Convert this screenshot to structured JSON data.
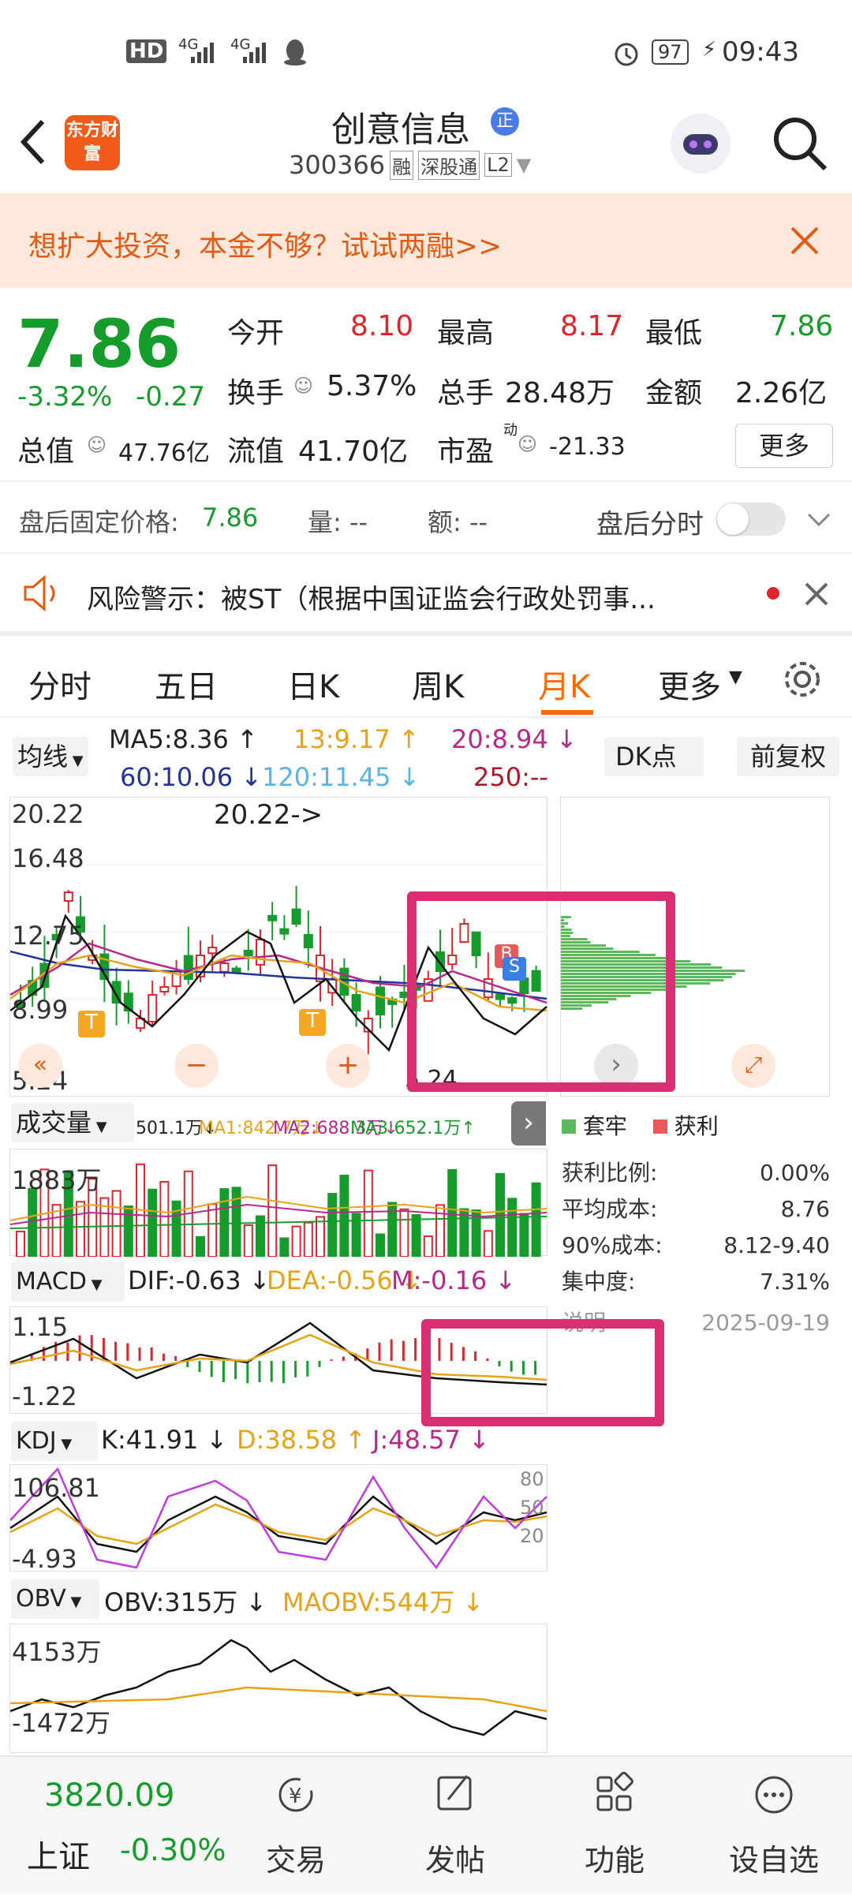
{
  "status_bar": {
    "net1": "4G",
    "net2": "4G",
    "battery": "97",
    "time": "09:43"
  },
  "header": {
    "logo_text": "东方财富",
    "stock_name": "创意信息",
    "name_badge": "正",
    "code": "300366",
    "tag1": "融",
    "tag2": "深股通",
    "tag3": "L2"
  },
  "banner": {
    "text": "想扩大投资，本金不够？试试两融>>"
  },
  "quote": {
    "price": "7.86",
    "change_pct": "-3.32%",
    "change": "-0.27",
    "open_label": "今开",
    "open": "8.10",
    "high_label": "最高",
    "high": "8.17",
    "low_label": "最低",
    "low": "7.86",
    "turnover_label": "换手",
    "turnover": "5.37%",
    "volume_label": "总手",
    "volume": "28.48万",
    "amount_label": "金额",
    "amount": "2.26亿",
    "mktcap_label": "总值",
    "mktcap": "47.76亿",
    "float_label": "流值",
    "float_cap": "41.70亿",
    "pe_label": "市盈",
    "pe_sup": "动",
    "pe": "-21.33",
    "more_label": "更多",
    "after_label": "盘后固定价格:",
    "after_price": "7.86",
    "after_vol": "量: --",
    "after_amt": "额: --",
    "after_timeshare": "盘后分时"
  },
  "warning": {
    "text": "风险警示：被ST（根据中国证监会行政处罚事..."
  },
  "tabs": [
    "分时",
    "五日",
    "日K",
    "周K",
    "月K",
    "更多"
  ],
  "ma": {
    "selector": "均线",
    "ma5": "MA5:8.36 ↑",
    "ma13": "13:9.17 ↑",
    "ma20": "20:8.94 ↓",
    "ma60": "60:10.06 ↓",
    "ma120": "120:11.45 ↓",
    "ma250": "250:--",
    "dk_button": "DK点",
    "adjust_button": "前复权"
  },
  "kline": {
    "y_top": "20.22",
    "y2": "16.48",
    "y3": "12.75",
    "y4": "8.99",
    "y_bottom": "5.24",
    "max_annot": "20.22->",
    "min_annot": "5.24",
    "marker_t": "T",
    "marker_b": "B",
    "marker_s": "S"
  },
  "volume": {
    "selector": "成交量",
    "v": "501.1万↓",
    "ma1": "MA1:842.7万↓",
    "ma2": "MA2:688.3万↓",
    "ma3": "MA3:652.1万↑",
    "y_top": "1883万"
  },
  "chip": {
    "legend_trap": "套牢",
    "legend_profit": "获利",
    "profit_ratio_label": "获利比例:",
    "profit_ratio": "0.00%",
    "avg_cost_label": "平均成本:",
    "avg_cost": "8.76",
    "cost90_label": "90%成本:",
    "cost90": "8.12-9.40",
    "concentration_label": "集中度:",
    "concentration": "7.31%",
    "note_label": "说明",
    "date": "2025-09-19"
  },
  "macd": {
    "selector": "MACD",
    "dif": "DIF:-0.63 ↓",
    "dea": "DEA:-0.56 ↓",
    "m": "M:-0.16 ↓",
    "y_top": "1.15",
    "y_bottom": "-1.22"
  },
  "kdj": {
    "selector": "KDJ",
    "k": "K:41.91 ↓",
    "d": "D:38.58 ↑",
    "j": "J:48.57 ↓",
    "y_top": "106.81",
    "y_bottom": "-4.93",
    "r80": "80",
    "r50": "50",
    "r20": "20"
  },
  "obv": {
    "selector": "OBV",
    "obv": "OBV:315万 ↓",
    "maobv": "MAOBV:544万 ↓",
    "y_top": "4153万",
    "y_bottom": "-1472万"
  },
  "bottom_nav": {
    "index_value": "3820.09",
    "index_name": "上证",
    "index_change": "-0.30%",
    "trade": "交易",
    "post": "发帖",
    "function": "功能",
    "watchlist": "设自选"
  },
  "colors": {
    "up": "#e0242d",
    "down": "#169c2b",
    "accent": "#ff6a00",
    "highlight": "#d92f72"
  }
}
